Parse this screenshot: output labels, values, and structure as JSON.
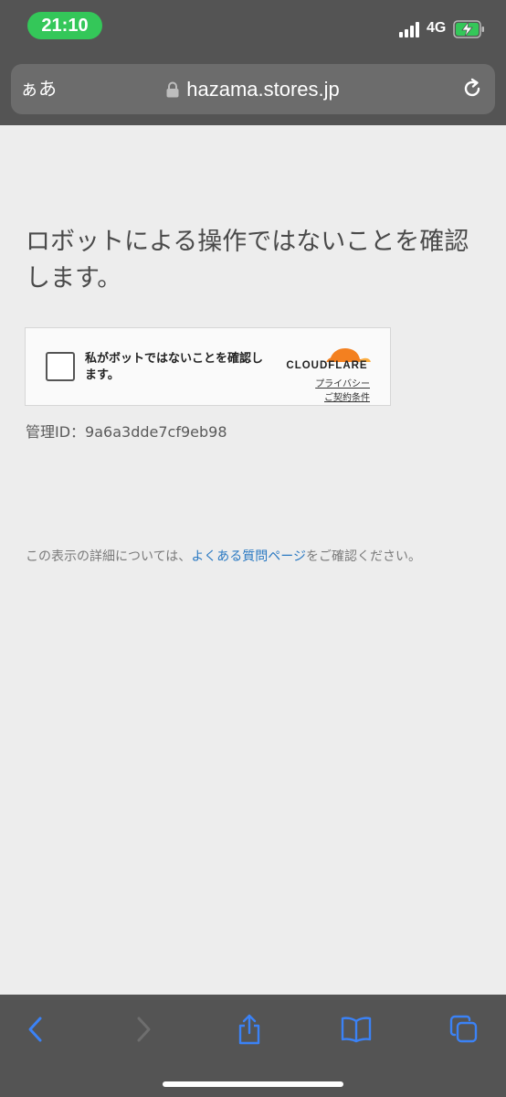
{
  "status_bar": {
    "time": "21:10",
    "network": "4G"
  },
  "browser": {
    "aa_label": "ぁあ",
    "url": "hazama.stores.jp"
  },
  "page": {
    "heading": "ロボットによる操作ではないことを確認します。",
    "captcha": {
      "label": "私がボットではないことを確認します。",
      "brand": "CLOUDFLARE",
      "privacy_link": "プライバシー",
      "terms_link": "ご契約条件"
    },
    "manage_id": {
      "label": "管理ID：",
      "value": "9a6a3dde7cf9eb98"
    },
    "notice": {
      "before": "この表示の詳細については、",
      "link": "よくある質問ページ",
      "after": "をご確認ください。"
    }
  },
  "colors": {
    "chrome": "#545454",
    "accent": "#3b82f6",
    "cloudflare_orange": "#f38020",
    "time_pill": "#34c759",
    "link": "#2a79c2"
  },
  "toolbar": {
    "icons": [
      "back-icon",
      "forward-icon",
      "share-icon",
      "bookmarks-icon",
      "tabs-icon"
    ]
  }
}
